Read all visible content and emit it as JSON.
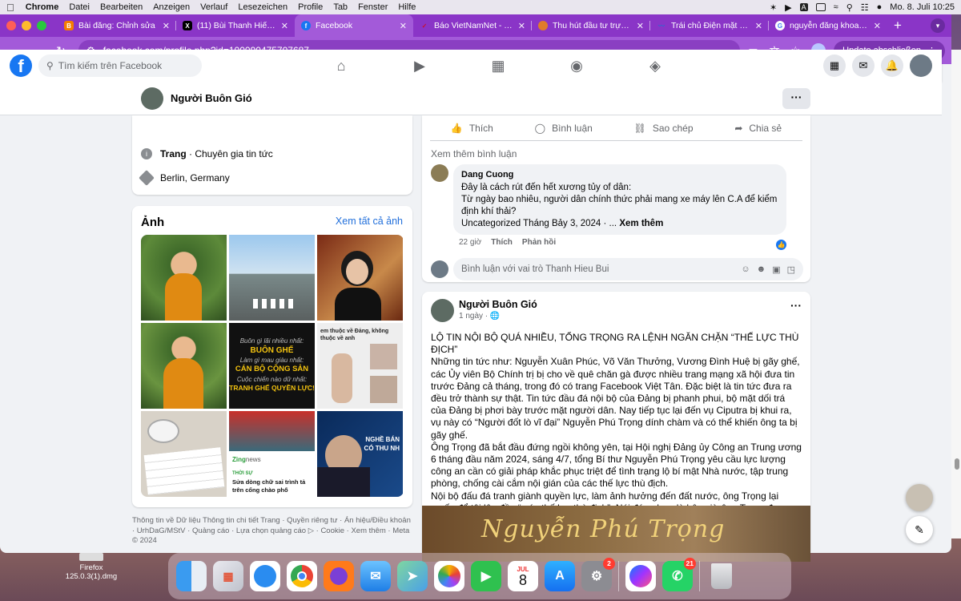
{
  "menubar": {
    "app": "Chrome",
    "items": [
      "Datei",
      "Bearbeiten",
      "Anzeigen",
      "Verlauf",
      "Lesezeichen",
      "Profile",
      "Tab",
      "Fenster",
      "Hilfe"
    ],
    "datetime": "Mo. 8. Juli  10:25",
    "input_source": "A"
  },
  "tabs": [
    {
      "title": "Bài đăng: Chỉnh sửa",
      "fav": "B",
      "color": "#f57d00"
    },
    {
      "title": "(11) Bùi Thanh Hiếu (@n",
      "fav": "X",
      "color": "#000000"
    },
    {
      "title": "Facebook",
      "fav": "f",
      "color": "#1877f2"
    },
    {
      "title": "Báo VietNamNet - Tin tứ",
      "fav": "v",
      "color": "#c8102e"
    },
    {
      "title": "Thu hút đầu tư trực tiếp",
      "fav": "t",
      "color": "#e07b2a"
    },
    {
      "title": "Trái chủ Điện mặt trời Tr",
      "fav": "~",
      "color": "#2a6bd1"
    },
    {
      "title": "nguyễn đăng khoa sinh n",
      "fav": "G",
      "color": "#ffffff"
    }
  ],
  "browser": {
    "url": "facebook.com/profile.php?id=100090475707687",
    "update_label": "Update abschließen"
  },
  "fb": {
    "search_placeholder": "Tìm kiếm trên Facebook"
  },
  "profile": {
    "name": "Người Buôn Gió",
    "info": {
      "page_label": "Trang",
      "page_rest": " · Chuyên gia tin tức",
      "location": "Berlin, Germany"
    },
    "photos_title": "Ảnh",
    "photos_link": "Xem tất cả ảnh",
    "photo_texts": {
      "p5_l1": "Buôn gì lãi nhiều nhất:",
      "p5_l2": "BUÔN GHẾ",
      "p5_l3": "Làm gì mau giàu nhất:",
      "p5_l4": "CÁN BỘ CỘNG SẢN",
      "p5_l5": "Cuộc chiến nào dữ nhất:",
      "p5_l6": "TRANH GHẾ QUYỀN LỰC!",
      "p6_caption": "em thuộc về Đảng, không thuộc về anh",
      "p8_brand": "Zing",
      "p8_news": "news",
      "p8_tag": "THỜI SỰ",
      "p8_title": "Sửa dòng chữ sai trình tả trên cổng chào phố",
      "p9_l1": "NGHỀ BÁN",
      "p9_l2": "CÓ THU NH"
    },
    "footer": "Thông tin về Dữ liệu Thông tin chi tiết Trang · Quyền riêng tư · Án hiệu/Điều khoản · UrhDaG/MStV · Quảng cáo · Lựa chọn quảng cáo ▷ · Cookie · Xem thêm · Meta © 2024"
  },
  "post1": {
    "actions": [
      "Thích",
      "Bình luận",
      "Sao chép",
      "Chia sẻ"
    ],
    "see_more_comments": "Xem thêm bình luận",
    "comment": {
      "author": "Dang Cuong",
      "line1": "Đây là cách rút đến hết xương tủy of dân:",
      "line2": "Từ ngày bao nhiêu, người dân chính thức phải mang xe máy lên C.A để kiểm định khí thải?",
      "line3": "Uncategorized Tháng Bảy 3, 2024 · ... ",
      "see_more": "Xem thêm",
      "time": "22 giờ",
      "like": "Thích",
      "reply": "Phản hồi"
    },
    "write_placeholder": "Bình luận với vai trò Thanh Hieu Bui"
  },
  "post2": {
    "author": "Người Buôn Gió",
    "time": "1 ngày · ",
    "p1": "LỘ TIN NỘI BỘ QUÁ NHIỀU, TỔNG TRỌNG RA LỆNH NGĂN CHẶN “THẾ LỰC THÙ ĐỊCH”",
    "p2": "Những tin tức như: Nguyễn Xuân Phúc, Võ Văn Thưởng, Vương Đình Huệ bị gãy ghế, các Ủy viên Bộ Chính trị bị cho về quê chăn gà được nhiều trang mạng xã hội đưa tin trước Đảng cả tháng, trong đó có trang Facebook Việt Tân. Đặc biệt là tin tức đưa ra đều trở thành sự thật. Tin tức đầu đá nội bộ của Đảng bị phanh phui, bộ mặt dối trá của Đảng bị phơi bày trước mặt người dân. Nay tiếp tục lại đến vụ Ciputra bị khui ra, vụ này có “Người đốt lò vĩ đại” Nguyễn Phú Trọng dính chàm và có thể khiến ông ta bị gãy ghế.",
    "p3": "Ông Trọng đã bắt đầu đứng ngồi không yên, tại Hội nghị Đảng ủy Công an Trung ương 6 tháng đầu năm 2024, sáng 4/7, tổng Bí thư Nguyễn Phú Trọng yêu cầu lực lượng công an cần có giải pháp khắc phục triệt để tình trạng lộ bí mật Nhà nước, tập trung phòng, chống cài cắm nội gián của các thế lực thù địch.",
    "p4": "Nội bộ đấu đá tranh giành quyền lực, làm ảnh hưởng đến đất nước, ông Trọng lại muốn đổ tội lên đầu “ các thế lực thù địch”. Nói đúng hơn là bây giờ ông Trọng đang run sợ vì lộ ra tham nhũng liên quan tới Ciputra cách đây 20 năm và đang tìm cách xử lý những ai khui ra sai phạm này của ông.",
    "image_text": "Nguyễn Phú Trọng"
  },
  "desktop": {
    "download": "Firefox\n125.0.3(1).dmg",
    "calendar_month": "JUL",
    "calendar_day": "8",
    "settings_badge": "2",
    "whatsapp_badge": "21"
  }
}
